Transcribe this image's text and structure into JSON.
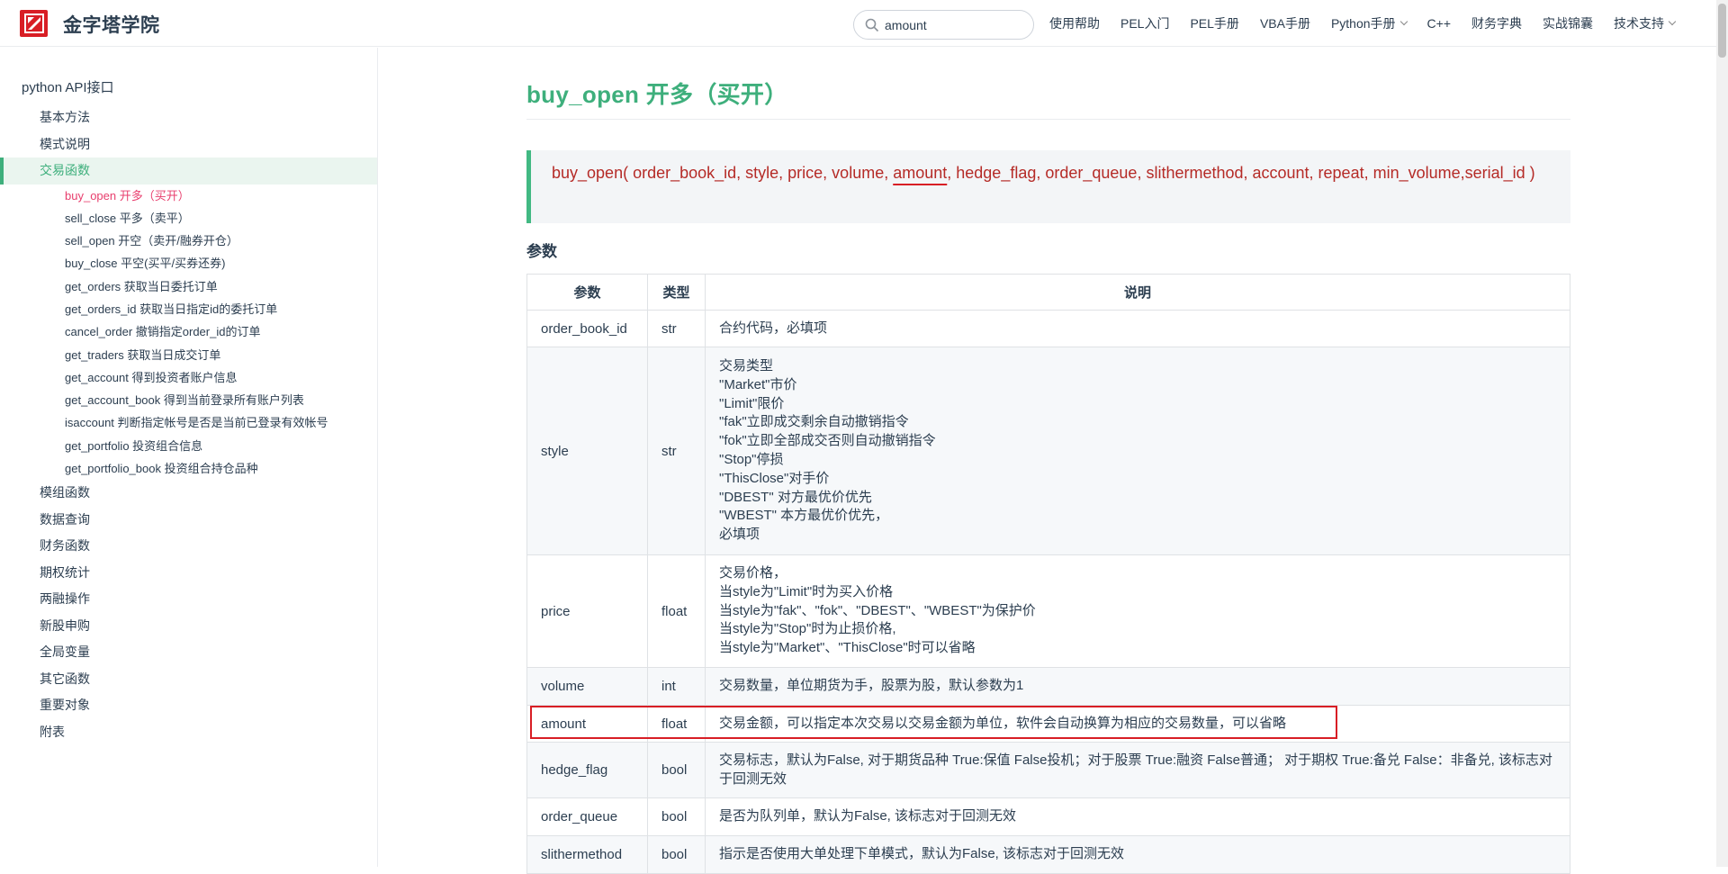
{
  "header": {
    "site_title": "金字塔学院",
    "search_value": "amount",
    "nav": [
      {
        "label": "使用帮助",
        "dropdown": false
      },
      {
        "label": "PEL入门",
        "dropdown": false
      },
      {
        "label": "PEL手册",
        "dropdown": false
      },
      {
        "label": "VBA手册",
        "dropdown": false
      },
      {
        "label": "Python手册",
        "dropdown": true
      },
      {
        "label": "C++",
        "dropdown": false
      },
      {
        "label": "财务字典",
        "dropdown": false
      },
      {
        "label": "实战锦囊",
        "dropdown": false
      },
      {
        "label": "技术支持",
        "dropdown": true
      }
    ],
    "brand_color": "#d81e25"
  },
  "sidebar": {
    "root": "python API接口",
    "items_before": [
      "基本方法",
      "模式说明"
    ],
    "active_item": "交易函数",
    "sub_items": [
      "buy_open 开多（买开）",
      "sell_close 平多（卖平）",
      "sell_open 开空（卖开/融券开仓）",
      "buy_close 平空(买平/买券还券)",
      "get_orders 获取当日委托订单",
      "get_orders_id 获取当日指定id的委托订单",
      "cancel_order 撤销指定order_id的订单",
      "get_traders 获取当日成交订单",
      "get_account 得到投资者账户信息",
      "get_account_book 得到当前登录所有账户列表",
      "isaccount 判断指定帐号是否是当前已登录有效帐号",
      "get_portfolio 投资组合信息",
      "get_portfolio_book 投资组合持仓品种"
    ],
    "items_after": [
      "模组函数",
      "数据查询",
      "财务函数",
      "期权统计",
      "两融操作",
      "新股申购",
      "全局变量",
      "其它函数",
      "重要对象",
      "附表"
    ],
    "accent_color": "#3eaf7c",
    "active_sub_color": "#e83e6d"
  },
  "main": {
    "title": "buy_open 开多（买开）",
    "signature_before": "buy_open( order_book_id, style, price, volume, ",
    "signature_amount": "amount",
    "signature_after": ", hedge_flag, order_queue, slithermethod, account, repeat, min_volume,serial_id )",
    "section_title": "参数",
    "table": {
      "headers": [
        "参数",
        "类型",
        "说明"
      ],
      "rows": [
        {
          "name": "order_book_id",
          "type": "str",
          "desc": "合约代码，必填项"
        },
        {
          "name": "style",
          "type": "str",
          "desc": "交易类型\n  \"Market\"市价\n  \"Limit\"限价\n  \"fak\"立即成交剩余自动撤销指令\n  \"fok\"立即全部成交否则自动撤销指令\n  \"Stop\"停损\n  \"ThisClose\"对手价\n  \"DBEST\" 对方最优价优先\n  \"WBEST\" 本方最优价优先，\n必填项"
        },
        {
          "name": "price",
          "type": "float",
          "desc": "交易价格，\n  当style为\"Limit\"时为买入价格\n  当style为\"fak\"、\"fok\"、\"DBEST\"、\"WBEST\"为保护价\n  当style为\"Stop\"时为止损价格,\n  当style为\"Market\"、\"ThisClose\"时可以省略"
        },
        {
          "name": "volume",
          "type": "int",
          "desc": "交易数量，单位期货为手，股票为股，默认参数为1"
        },
        {
          "name": "amount",
          "type": "float",
          "desc": "交易金额，可以指定本次交易以交易金额为单位，软件会自动换算为相应的交易数量，可以省略"
        },
        {
          "name": "hedge_flag",
          "type": "bool",
          "desc": "交易标志，默认为False, 对于期货品种 True:保值 False投机；对于股票 True:融资 False普通； 对于期权 True:备兑 False：非备兑, 该标志对于回测无效"
        },
        {
          "name": "order_queue",
          "type": "bool",
          "desc": "是否为队列单，默认为False, 该标志对于回测无效"
        },
        {
          "name": "slithermethod",
          "type": "bool",
          "desc": "指示是否使用大单处理下单模式，默认为False, 该标志对于回测无效"
        }
      ]
    }
  }
}
